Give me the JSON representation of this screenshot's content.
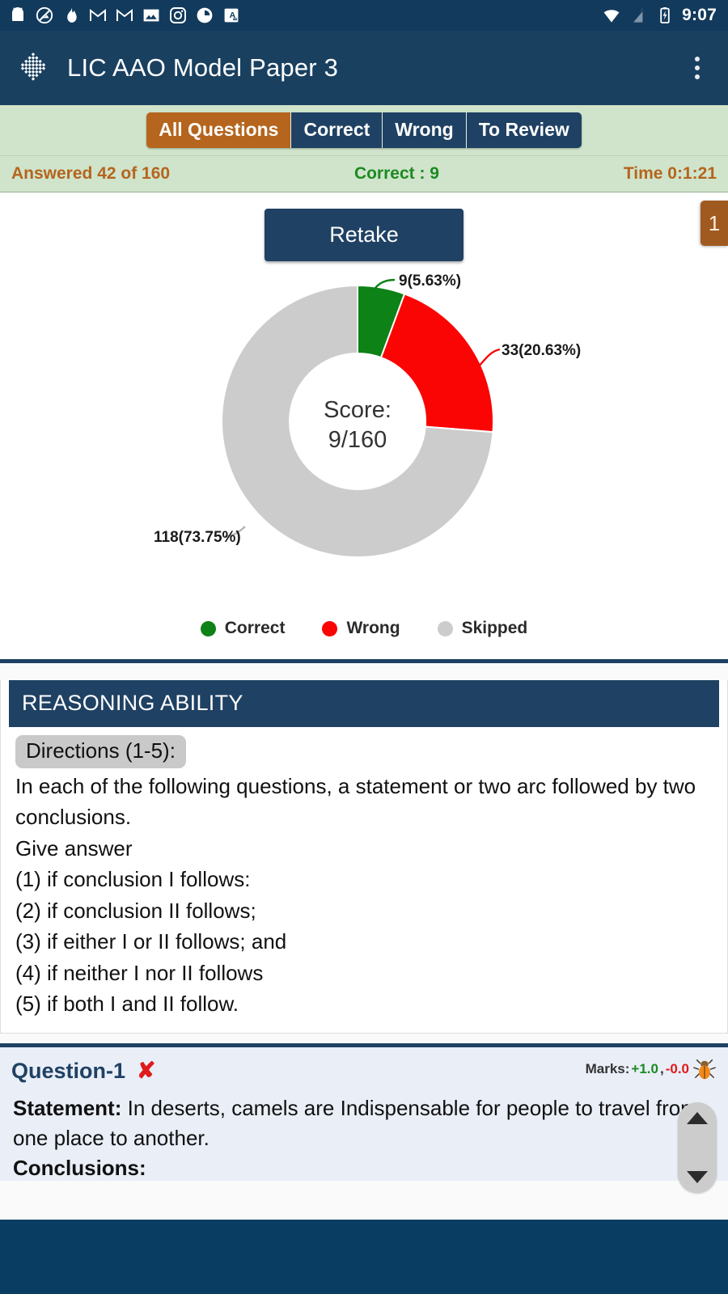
{
  "status_bar": {
    "time": "9:07",
    "left_icons": [
      "android-icon",
      "no-photo-icon",
      "fire-icon",
      "gmail-icon",
      "gmail-icon",
      "image-icon",
      "instagram-icon",
      "loading-circle-icon",
      "translate-icon"
    ],
    "right_icons": [
      "wifi-icon",
      "signal-off-icon",
      "battery-charging-icon"
    ]
  },
  "app_bar": {
    "logo": "app-logo-diamond-icon",
    "title": "LIC AAO Model Paper 3",
    "menu": "overflow-menu-icon"
  },
  "tabs": [
    {
      "label": "All Questions",
      "active": true
    },
    {
      "label": "Correct",
      "active": false
    },
    {
      "label": "Wrong",
      "active": false
    },
    {
      "label": "To Review",
      "active": false
    }
  ],
  "stats": {
    "answered": "Answered 42 of 160",
    "correct": "Correct : 9",
    "time": "Time 0:1:21"
  },
  "actions": {
    "retake_label": "Retake",
    "page_badge": "1"
  },
  "chart_data": {
    "type": "pie",
    "variant": "donut",
    "title": "",
    "center_label_line1": "Score:",
    "center_label_line2": "9/160",
    "total": 160,
    "start_angle_deg": -90,
    "direction": "clockwise",
    "categories": [
      "Correct",
      "Wrong",
      "Skipped"
    ],
    "values": [
      9,
      33,
      118
    ],
    "percentages": [
      5.63,
      20.63,
      73.75
    ],
    "data_labels": [
      "9(5.63%)",
      "33(20.63%)",
      "118(73.75%)"
    ],
    "colors": [
      "#0d8216",
      "#fb0404",
      "#cccccc"
    ],
    "legend": {
      "position": "bottom",
      "entries": [
        {
          "label": "Correct",
          "color": "#0d8216"
        },
        {
          "label": "Wrong",
          "color": "#fb0404"
        },
        {
          "label": "Skipped",
          "color": "#cccccc"
        }
      ]
    }
  },
  "section": {
    "heading": "REASONING ABILITY",
    "directions_tag": "Directions (1-5):",
    "directions_lines": [
      "In each of the following questions, a statement or two arc followed by two conclusions.",
      "Give answer",
      "(1) if conclusion I follows:",
      "(2) if conclusion II follows;",
      "(3) if either I or II follows; and",
      "(4) if neither I nor II follows",
      "(5) if both I and II follow."
    ]
  },
  "question": {
    "title": "Question-1",
    "result_icon": "wrong-cross-icon",
    "result_mark": "✘",
    "marks_label": "Marks:",
    "marks_positive": "+1.0",
    "marks_separator": ",",
    "marks_negative": "-0.0",
    "report_icon": "bug-report-icon",
    "statement_label": "Statement:",
    "statement_text": "In deserts, camels are Indispensable for people to travel from one place to another.",
    "conclusions_label": "Conclusions:"
  },
  "scroll_controls": {
    "up": "scroll-up-icon",
    "down": "scroll-down-icon"
  },
  "theme": {
    "navy": "#1f4163",
    "appbar": "#1a4060",
    "statusbar": "#123a5c",
    "orange": "#b5651d",
    "green_pale": "#cfe4cb",
    "correct_green": "#1d8a22",
    "wrong_red": "#e01b1b",
    "bottom_nav": "#0a3d62"
  }
}
